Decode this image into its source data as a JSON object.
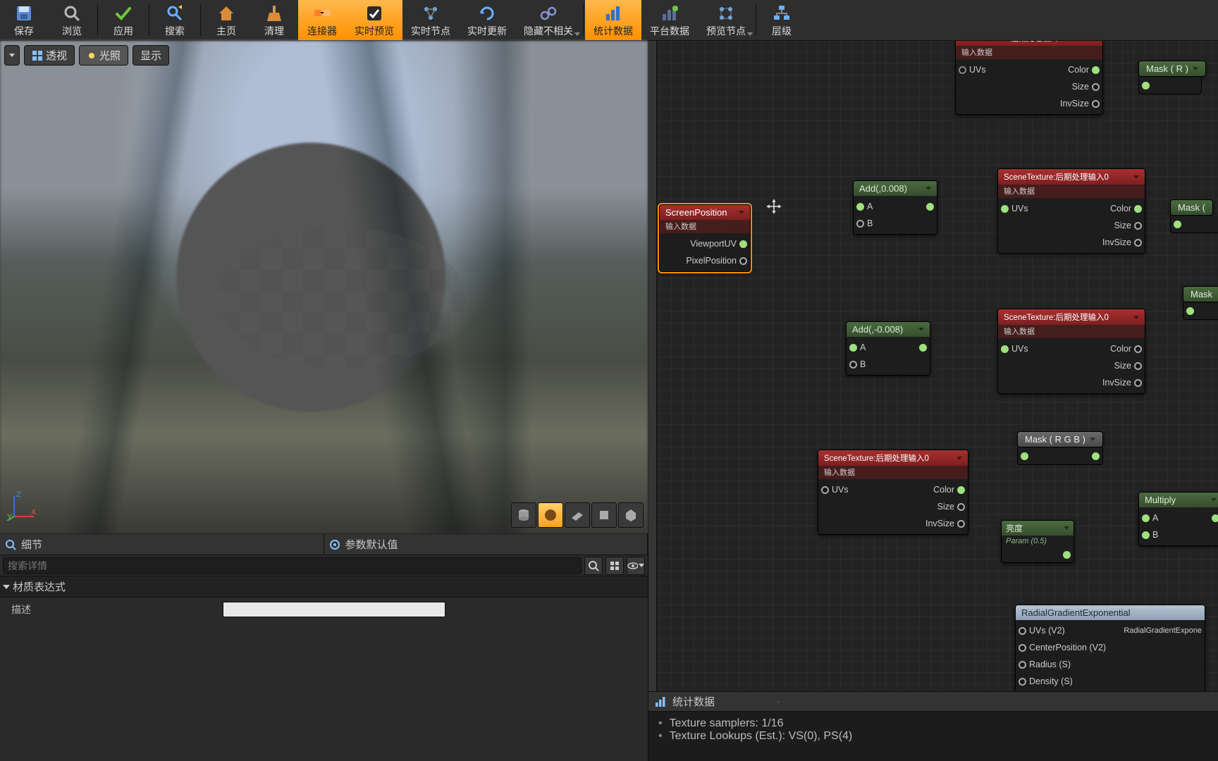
{
  "toolbar": {
    "items": [
      {
        "label": "保存",
        "icon": "save"
      },
      {
        "label": "浏览",
        "icon": "browse"
      },
      {
        "label": "应用",
        "icon": "apply"
      },
      {
        "label": "搜索",
        "icon": "search"
      },
      {
        "label": "主页",
        "icon": "home"
      },
      {
        "label": "清理",
        "icon": "clean"
      },
      {
        "label": "连接器",
        "icon": "connector",
        "active": true
      },
      {
        "label": "实时预览",
        "icon": "live-preview",
        "active": true
      },
      {
        "label": "实时节点",
        "icon": "live-nodes"
      },
      {
        "label": "实时更新",
        "icon": "live-update"
      },
      {
        "label": "隐藏不相关",
        "icon": "hide",
        "caret": true
      },
      {
        "label": "统计数据",
        "icon": "stats",
        "active": true
      },
      {
        "label": "平台数据",
        "icon": "platform"
      },
      {
        "label": "预览节点",
        "icon": "preview-node",
        "caret": true
      },
      {
        "label": "层级",
        "icon": "hierarchy"
      }
    ]
  },
  "viewport": {
    "buttons": {
      "perspective": "透视",
      "lit": "光照",
      "show": "显示"
    },
    "axes": {
      "x": "X",
      "y": "Y",
      "z": "Z"
    }
  },
  "details": {
    "tabs": {
      "details": "细节",
      "defaults": "参数默认值"
    },
    "search_placeholder": "搜索详情",
    "section": "材质表达式",
    "row_label": "描述",
    "row_value": ""
  },
  "graph": {
    "screenPosition": {
      "title": "ScreenPosition",
      "sub": "输入数据",
      "out1": "ViewportUV",
      "out2": "PixelPosition"
    },
    "sceneTex": {
      "title": "SceneTexture:后期处理输入0",
      "sub": "输入数据",
      "in": "UVs",
      "out_color": "Color",
      "out_size": "Size",
      "out_inv": "InvSize"
    },
    "add1": {
      "title": "Add(,0.008)",
      "a": "A",
      "b": "B"
    },
    "add2": {
      "title": "Add(,-0.008)",
      "a": "A",
      "b": "B"
    },
    "maskR": "Mask ( R )",
    "mask": "Mask (",
    "mask2": "Mask",
    "maskRGB": "Mask ( R G B )",
    "multiply": {
      "title": "Multiply",
      "a": "A",
      "b": "B"
    },
    "brightness": {
      "title": "亮度",
      "value": "Param (0.5)"
    },
    "radial": {
      "title": "RadialGradientExponential",
      "in1": "UVs (V2)",
      "in2": "CenterPosition (V2)",
      "in3": "Radius (S)",
      "in4": "Density (S)",
      "out": "RadialGradientExpone"
    }
  },
  "stats": {
    "title": "统计数据",
    "line1": "Texture samplers: 1/16",
    "line2": "Texture Lookups (Est.): VS(0), PS(4)"
  }
}
